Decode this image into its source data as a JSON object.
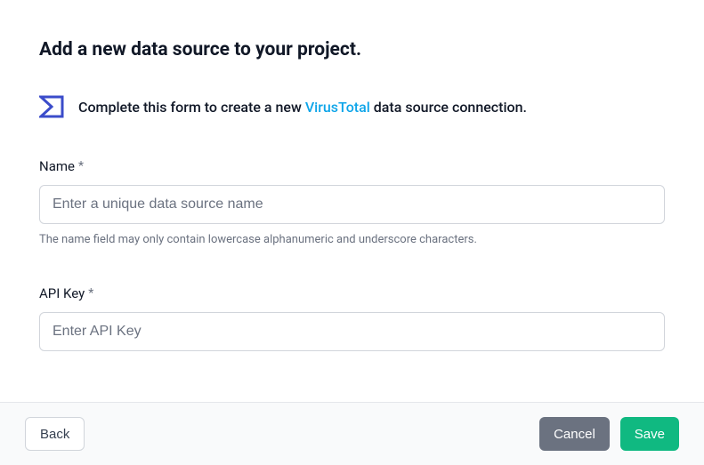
{
  "header": {
    "title": "Add a new data source to your project."
  },
  "banner": {
    "prefix": "Complete this form to create a new ",
    "provider": "VirusTotal",
    "suffix": " data source connection."
  },
  "form": {
    "name": {
      "label": "Name",
      "required_mark": "*",
      "placeholder": "Enter a unique data source name",
      "value": "",
      "help": "The name field may only contain lowercase alphanumeric and underscore characters."
    },
    "api_key": {
      "label": "API Key",
      "required_mark": "*",
      "placeholder": "Enter API Key",
      "value": ""
    }
  },
  "footer": {
    "back": "Back",
    "cancel": "Cancel",
    "save": "Save"
  },
  "colors": {
    "accent_link": "#0EA5E9",
    "logo_primary": "#3B4CCA",
    "save": "#10B981",
    "cancel": "#6B7280"
  }
}
